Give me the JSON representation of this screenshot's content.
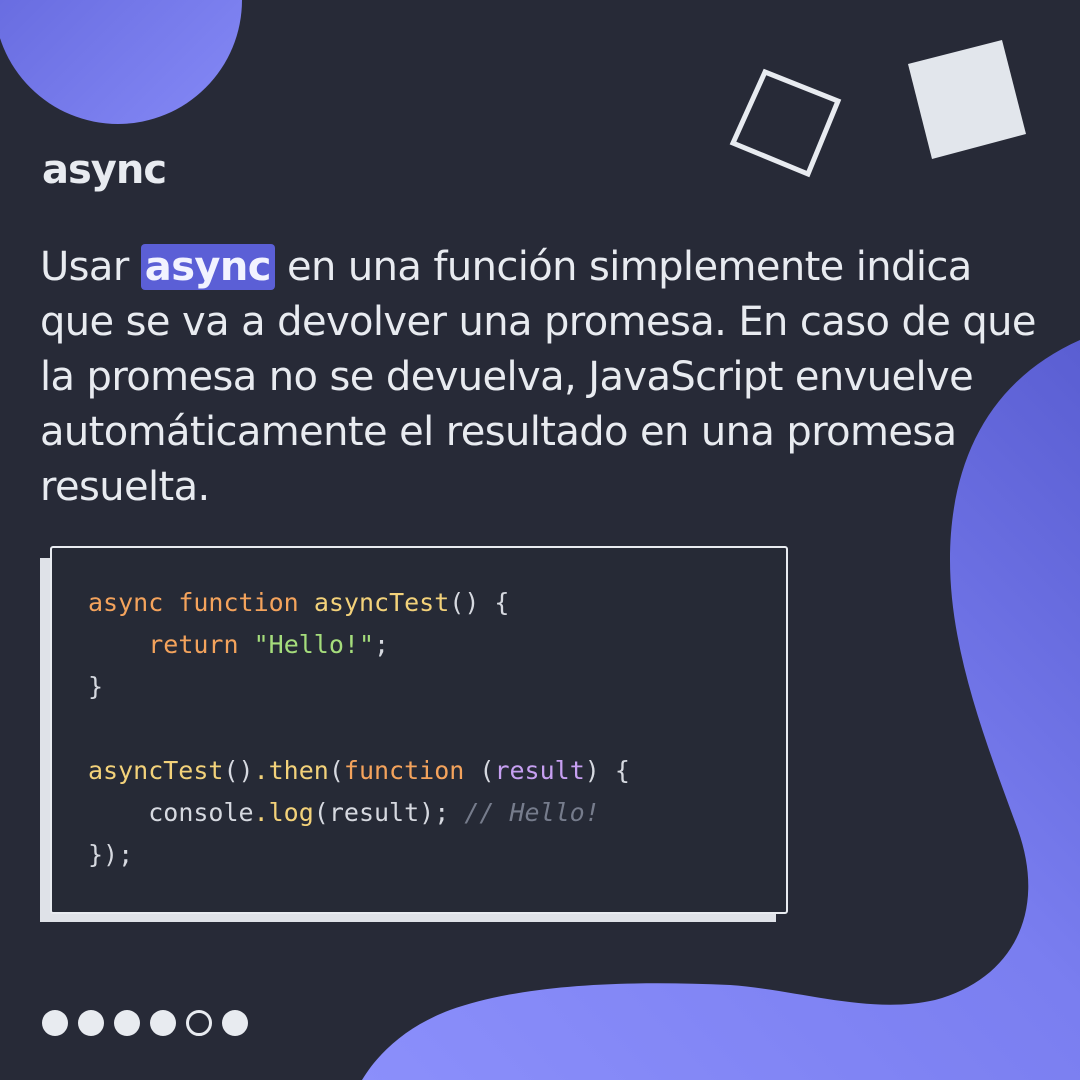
{
  "slide": {
    "title": "async",
    "description": {
      "before": "Usar ",
      "highlight": "async",
      "after": " en una función simplemente indica que se va a devolver una promesa. En caso de que la promesa no se devuelva, JavaScript envuelve automáticamente el resultado en una promesa resuelta."
    }
  },
  "code": {
    "l1_kw1": "async",
    "l1_kw2": "function",
    "l1_fn": "asyncTest",
    "l1_rest": "() {",
    "l2_kw": "return",
    "l2_str": "\"Hello!\"",
    "l2_end": ";",
    "l3": "}",
    "l5_fn": "asyncTest",
    "l5_a": "()",
    "l5_then": ".then",
    "l5_b": "(",
    "l5_kw": "function",
    "l5_c": " (",
    "l5_param": "result",
    "l5_d": ") {",
    "l6_obj": "console",
    "l6_log": ".log",
    "l6_rest": "(result);",
    "l6_comment": "// Hello!",
    "l7": "});"
  },
  "pagination": {
    "total": 6,
    "current": 5
  },
  "colors": {
    "background": "#272a37",
    "accent": "#7b7ff2",
    "highlight": "#5b5fd6",
    "text": "#e8ebf0",
    "code_keyword": "#f4a35c",
    "code_function": "#f3d27a",
    "code_string": "#a5dd7c",
    "code_param": "#c7a0f2",
    "code_comment": "#767c8c"
  }
}
